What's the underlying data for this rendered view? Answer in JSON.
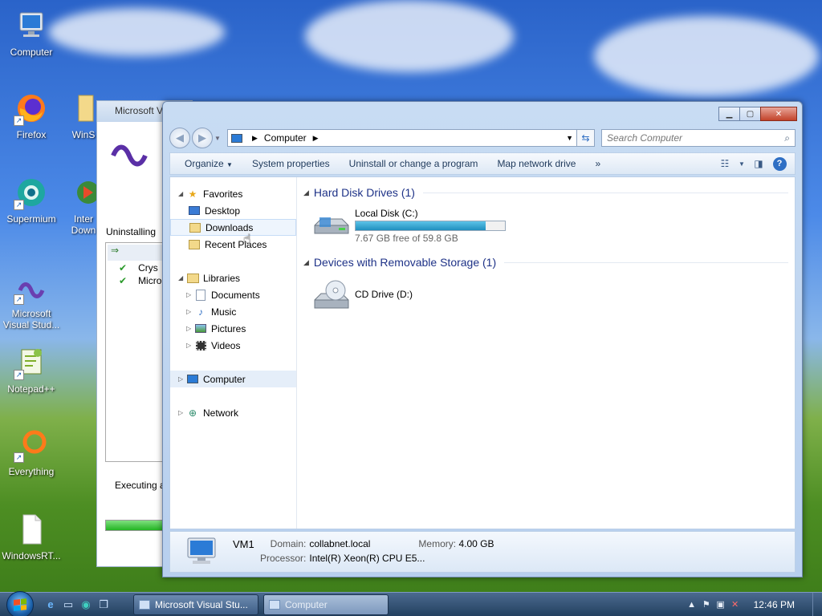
{
  "desktop": {
    "icons": [
      {
        "label": "Computer",
        "icon": "computer-icon"
      },
      {
        "label": "Firefox",
        "icon": "firefox-icon"
      },
      {
        "label": "Supermium",
        "icon": "supermium-icon"
      },
      {
        "label": "Microsoft Visual Stud...",
        "icon": "visual-studio-icon"
      },
      {
        "label": "Notepad++",
        "icon": "notepadpp-icon"
      },
      {
        "label": "Everything",
        "icon": "everything-icon"
      },
      {
        "label": "WindowsRT...",
        "icon": "document-icon"
      },
      {
        "label": "WinS",
        "icon": "folder-icon"
      },
      {
        "label": "Inter Down",
        "icon": "idm-icon"
      }
    ]
  },
  "background_window": {
    "title": "Microsoft V",
    "status": "Uninstalling",
    "items": [
      "Crys",
      "Micro"
    ],
    "executing": "Executing ac"
  },
  "explorer": {
    "address": {
      "crumb": "Computer"
    },
    "search": {
      "placeholder": "Search Computer"
    },
    "toolbar": {
      "organize": "Organize",
      "system_properties": "System properties",
      "uninstall": "Uninstall or change a program",
      "map_drive": "Map network drive",
      "more": "»"
    },
    "nav": {
      "favorites": "Favorites",
      "desktop": "Desktop",
      "downloads": "Downloads",
      "recent": "Recent Places",
      "libraries": "Libraries",
      "documents": "Documents",
      "music": "Music",
      "pictures": "Pictures",
      "videos": "Videos",
      "computer": "Computer",
      "network": "Network"
    },
    "groups": {
      "hdd": "Hard Disk Drives (1)",
      "removable": "Devices with Removable Storage (1)"
    },
    "drives": {
      "c": {
        "name": "Local Disk (C:)",
        "free_text": "7.67 GB free of 59.8 GB",
        "used_fraction": 0.872
      },
      "d": {
        "name": "CD Drive (D:)"
      }
    },
    "details": {
      "name": "VM1",
      "domain_label": "Domain:",
      "domain_value": "collabnet.local",
      "memory_label": "Memory:",
      "memory_value": "4.00 GB",
      "processor_label": "Processor:",
      "processor_value": "Intel(R) Xeon(R) CPU E5..."
    }
  },
  "taskbar": {
    "tasks": [
      "Microsoft Visual Stu...",
      "Computer"
    ],
    "clock": "12:46 PM"
  },
  "colors": {
    "accent": "#1e3287",
    "drive_fill": "#1f8fbe"
  }
}
